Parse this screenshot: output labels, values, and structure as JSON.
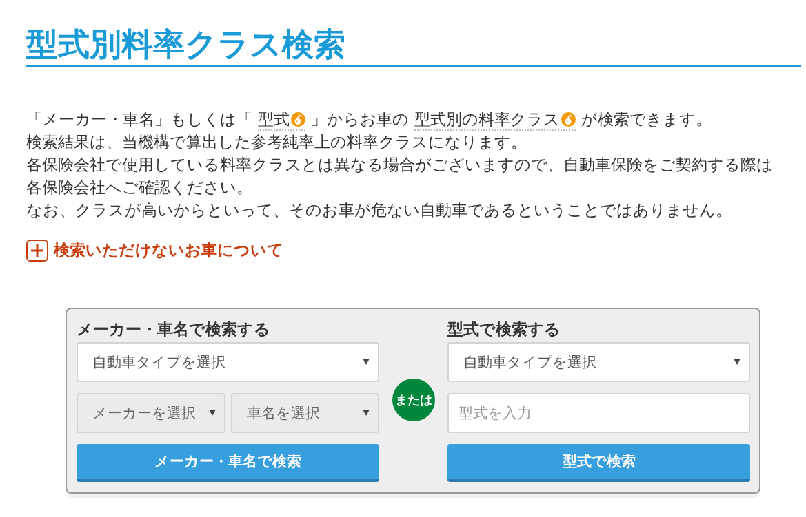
{
  "page_title": "型式別料率クラス検索",
  "intro": {
    "lines": [
      {
        "parts": [
          {
            "kind": "text",
            "text": "「メーカー・車名」もしくは「"
          },
          {
            "kind": "term",
            "text": "型式"
          },
          {
            "kind": "text",
            "text": "」からお車の"
          },
          {
            "kind": "term",
            "text": "型式別の料率クラス"
          },
          {
            "kind": "text",
            "text": "が検索できます。"
          }
        ]
      },
      {
        "parts": [
          {
            "kind": "text",
            "text": "検索結果は、当機構で算出した参考純率上の料率クラスになります。"
          }
        ]
      },
      {
        "parts": [
          {
            "kind": "text",
            "text": "各保険会社で使用している料率クラスとは異なる場合がございますので、自動車保険をご契約する際は"
          }
        ]
      },
      {
        "parts": [
          {
            "kind": "text",
            "text": "各保険会社へご確認ください。"
          }
        ]
      },
      {
        "parts": [
          {
            "kind": "text",
            "text": "なお、クラスが高いからといって、そのお車が危ない自動車であるということではありません。"
          }
        ]
      }
    ]
  },
  "expand_link": {
    "label": "検索いただけないお車について",
    "expanded": false
  },
  "search_panel": {
    "by_name": {
      "heading": "メーカー・車名で検索する",
      "rows": [
        [
          {
            "kind": "select",
            "value": "自動車タイプを選択",
            "disabled": false
          }
        ],
        [
          {
            "kind": "select",
            "value": "メーカーを選択",
            "disabled": true
          },
          {
            "kind": "select",
            "value": "車名を選択",
            "disabled": true
          }
        ]
      ],
      "button": "メーカー・車名で検索"
    },
    "separator": "または",
    "by_model": {
      "heading": "型式で検索する",
      "rows": [
        [
          {
            "kind": "select",
            "value": "自動車タイプを選択",
            "disabled": false
          }
        ],
        [
          {
            "kind": "input",
            "placeholder": "型式を入力"
          }
        ]
      ],
      "button": "型式で検索"
    }
  }
}
